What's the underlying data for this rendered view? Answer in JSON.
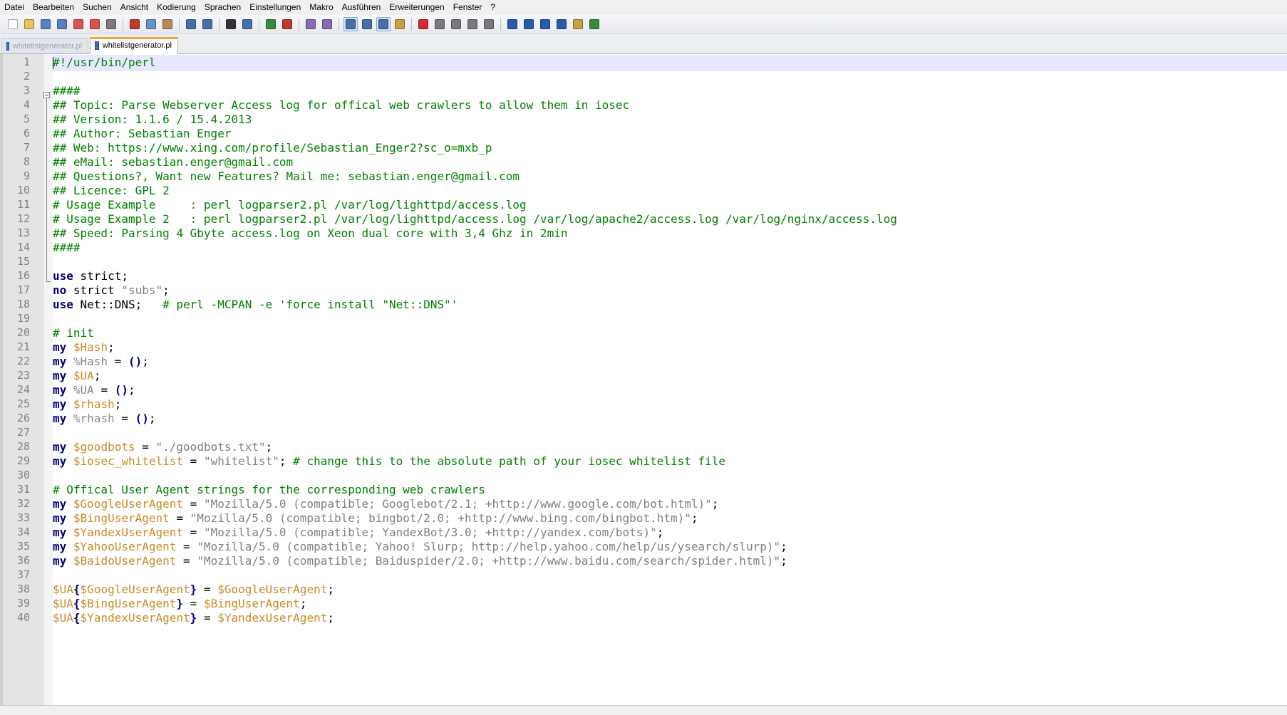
{
  "menu": [
    "Datei",
    "Bearbeiten",
    "Suchen",
    "Ansicht",
    "Kodierung",
    "Sprachen",
    "Einstellungen",
    "Makro",
    "Ausführen",
    "Erweiterungen",
    "Fenster",
    "?"
  ],
  "toolbar": {
    "groups": [
      [
        {
          "icon": "new-file-icon",
          "color": "#ffffff"
        },
        {
          "icon": "open-file-icon",
          "color": "#e8c25a"
        },
        {
          "icon": "save-icon",
          "color": "#5a7fc0"
        },
        {
          "icon": "save-all-icon",
          "color": "#5a7fc0"
        },
        {
          "icon": "close-icon",
          "color": "#d9534f"
        },
        {
          "icon": "close-all-icon",
          "color": "#d9534f"
        },
        {
          "icon": "print-icon",
          "color": "#7a7a7a"
        }
      ],
      [
        {
          "icon": "cut-icon",
          "color": "#c0392b"
        },
        {
          "icon": "copy-icon",
          "color": "#6b8fc7"
        },
        {
          "icon": "paste-icon",
          "color": "#b5895a"
        }
      ],
      [
        {
          "icon": "undo-icon",
          "color": "#4a6ea8"
        },
        {
          "icon": "redo-icon",
          "color": "#4a6ea8"
        }
      ],
      [
        {
          "icon": "find-icon",
          "color": "#333333"
        },
        {
          "icon": "replace-icon",
          "color": "#4a6ea8"
        }
      ],
      [
        {
          "icon": "zoom-in-icon",
          "color": "#3a8a3a"
        },
        {
          "icon": "zoom-out-icon",
          "color": "#c0392b"
        }
      ],
      [
        {
          "icon": "sync-vertical-icon",
          "color": "#8a6ab0"
        },
        {
          "icon": "sync-horizontal-icon",
          "color": "#8a6ab0"
        }
      ],
      [
        {
          "icon": "word-wrap-icon",
          "color": "#4a6ea8",
          "pressed": true
        },
        {
          "icon": "show-all-chars-icon",
          "color": "#4a6ea8"
        },
        {
          "icon": "indent-guide-icon",
          "color": "#4a6ea8",
          "pressed": true
        },
        {
          "icon": "user-defined-dialog-icon",
          "color": "#c9a040"
        }
      ],
      [
        {
          "icon": "record-macro-icon",
          "color": "#d9263a"
        },
        {
          "icon": "stop-record-icon",
          "color": "#7a7a7a"
        },
        {
          "icon": "play-macro-icon",
          "color": "#7a7a7a"
        },
        {
          "icon": "run-macro-multiple-icon",
          "color": "#7a7a7a"
        },
        {
          "icon": "save-macro-icon",
          "color": "#7a7a7a"
        }
      ],
      [
        {
          "icon": "function-list-icon",
          "color": "#2a5aa8"
        },
        {
          "icon": "move-up-icon",
          "color": "#2a5aa8"
        },
        {
          "icon": "move-down-icon",
          "color": "#2a5aa8"
        },
        {
          "icon": "sort-icon",
          "color": "#2a5aa8"
        },
        {
          "icon": "document-map-icon",
          "color": "#c9a040"
        },
        {
          "icon": "spell-check-icon",
          "color": "#3a8a3a"
        }
      ]
    ]
  },
  "tabs": [
    {
      "label": "whitelistgenerator.pl",
      "active": false
    },
    {
      "label": "whitelistgenerator.pl",
      "active": true
    }
  ],
  "editor": {
    "lines": [
      [
        [
          "c",
          "#!/usr/bin/perl"
        ]
      ],
      [],
      [
        [
          "c",
          "####"
        ]
      ],
      [
        [
          "c",
          "## Topic: Parse Webserver Access log for offical web crawlers to allow them in iosec"
        ]
      ],
      [
        [
          "c",
          "## Version: 1.1.6 / 15.4.2013"
        ]
      ],
      [
        [
          "c",
          "## Author: Sebastian Enger"
        ]
      ],
      [
        [
          "c",
          "## Web: https://www.xing.com/profile/Sebastian_Enger2?sc_o=mxb_p"
        ]
      ],
      [
        [
          "c",
          "## eMail: sebastian.enger@gmail.com"
        ]
      ],
      [
        [
          "c",
          "## Questions?, Want new Features? Mail me: sebastian.enger@gmail.com"
        ]
      ],
      [
        [
          "c",
          "## Licence: GPL 2"
        ]
      ],
      [
        [
          "c",
          "# Usage Example     : perl logparser2.pl /var/log/lighttpd/access.log"
        ]
      ],
      [
        [
          "c",
          "# Usage Example 2   : perl logparser2.pl /var/log/lighttpd/access.log /var/log/apache2/access.log /var/log/nginx/access.log"
        ]
      ],
      [
        [
          "c",
          "## Speed: Parsing 4 Gbyte access.log on Xeon dual core with 3,4 Ghz in 2min"
        ]
      ],
      [
        [
          "c",
          "####"
        ]
      ],
      [],
      [
        [
          "k",
          "use"
        ],
        [
          "p",
          " strict;"
        ]
      ],
      [
        [
          "k",
          "no"
        ],
        [
          "p",
          " strict "
        ],
        [
          "s",
          "\"subs\""
        ],
        [
          "p",
          ";"
        ]
      ],
      [
        [
          "k",
          "use"
        ],
        [
          "p",
          " Net::DNS;   "
        ],
        [
          "c",
          "# perl -MCPAN -e 'force install \"Net::DNS\"'"
        ]
      ],
      [],
      [
        [
          "c",
          "# init"
        ]
      ],
      [
        [
          "k",
          "my"
        ],
        [
          "p",
          " "
        ],
        [
          "v",
          "$Hash"
        ],
        [
          "p",
          ";"
        ]
      ],
      [
        [
          "k",
          "my"
        ],
        [
          "p",
          " "
        ],
        [
          "h",
          "%Hash"
        ],
        [
          "p",
          " = "
        ],
        [
          "o",
          "()"
        ],
        [
          "p",
          ";"
        ]
      ],
      [
        [
          "k",
          "my"
        ],
        [
          "p",
          " "
        ],
        [
          "v",
          "$UA"
        ],
        [
          "p",
          ";"
        ]
      ],
      [
        [
          "k",
          "my"
        ],
        [
          "p",
          " "
        ],
        [
          "h",
          "%UA"
        ],
        [
          "p",
          " = "
        ],
        [
          "o",
          "()"
        ],
        [
          "p",
          ";"
        ]
      ],
      [
        [
          "k",
          "my"
        ],
        [
          "p",
          " "
        ],
        [
          "v",
          "$rhash"
        ],
        [
          "p",
          ";"
        ]
      ],
      [
        [
          "k",
          "my"
        ],
        [
          "p",
          " "
        ],
        [
          "h",
          "%rhash"
        ],
        [
          "p",
          " = "
        ],
        [
          "o",
          "()"
        ],
        [
          "p",
          ";"
        ]
      ],
      [],
      [
        [
          "k",
          "my"
        ],
        [
          "p",
          " "
        ],
        [
          "v",
          "$goodbots"
        ],
        [
          "p",
          " = "
        ],
        [
          "s",
          "\"./goodbots.txt\""
        ],
        [
          "p",
          ";"
        ]
      ],
      [
        [
          "k",
          "my"
        ],
        [
          "p",
          " "
        ],
        [
          "v",
          "$iosec_whitelist"
        ],
        [
          "p",
          " = "
        ],
        [
          "s",
          "\"whitelist\""
        ],
        [
          "p",
          "; "
        ],
        [
          "c",
          "# change this to the absolute path of your iosec whitelist file"
        ]
      ],
      [],
      [
        [
          "c",
          "# Offical User Agent strings for the corresponding web crawlers"
        ]
      ],
      [
        [
          "k",
          "my"
        ],
        [
          "p",
          " "
        ],
        [
          "v",
          "$GoogleUserAgent"
        ],
        [
          "p",
          " = "
        ],
        [
          "s",
          "\"Mozilla/5.0 (compatible; Googlebot/2.1; +http://www.google.com/bot.html)\""
        ],
        [
          "p",
          ";"
        ]
      ],
      [
        [
          "k",
          "my"
        ],
        [
          "p",
          " "
        ],
        [
          "v",
          "$BingUserAgent"
        ],
        [
          "p",
          " = "
        ],
        [
          "s",
          "\"Mozilla/5.0 (compatible; bingbot/2.0; +http://www.bing.com/bingbot.htm)\""
        ],
        [
          "p",
          ";"
        ]
      ],
      [
        [
          "k",
          "my"
        ],
        [
          "p",
          " "
        ],
        [
          "v",
          "$YandexUserAgent"
        ],
        [
          "p",
          " = "
        ],
        [
          "s",
          "\"Mozilla/5.0 (compatible; YandexBot/3.0; +http://yandex.com/bots)\""
        ],
        [
          "p",
          ";"
        ]
      ],
      [
        [
          "k",
          "my"
        ],
        [
          "p",
          " "
        ],
        [
          "v",
          "$YahooUserAgent"
        ],
        [
          "p",
          " = "
        ],
        [
          "s",
          "\"Mozilla/5.0 (compatible; Yahoo! Slurp; http://help.yahoo.com/help/us/ysearch/slurp)\""
        ],
        [
          "p",
          ";"
        ]
      ],
      [
        [
          "k",
          "my"
        ],
        [
          "p",
          " "
        ],
        [
          "v",
          "$BaidoUserAgent"
        ],
        [
          "p",
          " = "
        ],
        [
          "s",
          "\"Mozilla/5.0 (compatible; Baiduspider/2.0; +http://www.baidu.com/search/spider.html)\""
        ],
        [
          "p",
          ";"
        ]
      ],
      [],
      [
        [
          "v",
          "$UA"
        ],
        [
          "o",
          "{"
        ],
        [
          "v",
          "$GoogleUserAgent"
        ],
        [
          "o",
          "}"
        ],
        [
          "p",
          " = "
        ],
        [
          "v",
          "$GoogleUserAgent"
        ],
        [
          "p",
          ";"
        ]
      ],
      [
        [
          "v",
          "$UA"
        ],
        [
          "o",
          "{"
        ],
        [
          "v",
          "$BingUserAgent"
        ],
        [
          "o",
          "}"
        ],
        [
          "p",
          " = "
        ],
        [
          "v",
          "$BingUserAgent"
        ],
        [
          "p",
          ";"
        ]
      ],
      [
        [
          "v",
          "$UA"
        ],
        [
          "o",
          "{"
        ],
        [
          "v",
          "$YandexUserAgent"
        ],
        [
          "o",
          "}"
        ],
        [
          "p",
          " = "
        ],
        [
          "v",
          "$YandexUserAgent"
        ],
        [
          "p",
          ";"
        ]
      ]
    ]
  }
}
